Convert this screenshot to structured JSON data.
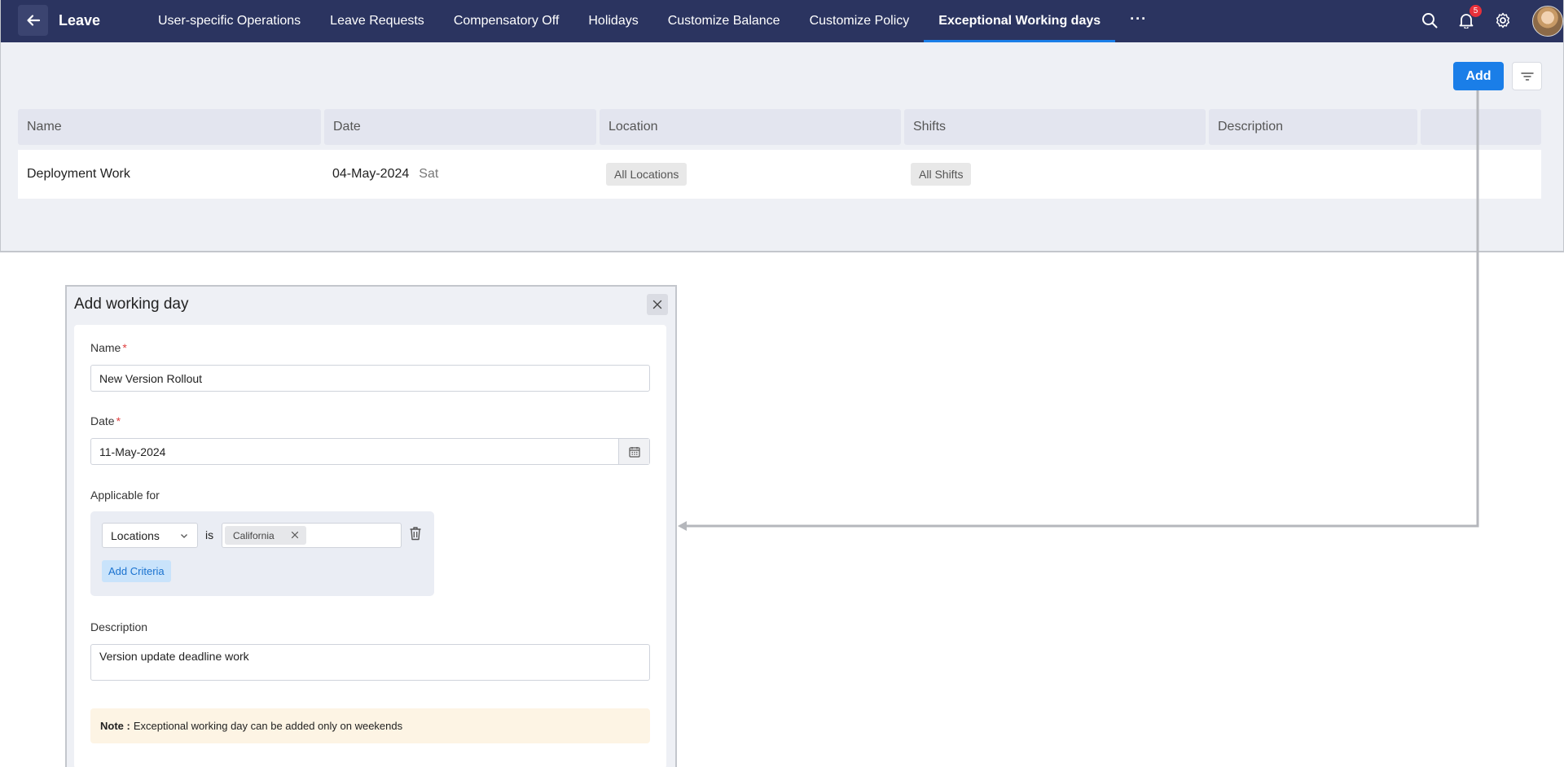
{
  "topnav": {
    "app_title": "Leave",
    "tabs": [
      {
        "label": "User-specific Operations"
      },
      {
        "label": "Leave Requests"
      },
      {
        "label": "Compensatory Off"
      },
      {
        "label": "Holidays"
      },
      {
        "label": "Customize Balance"
      },
      {
        "label": "Customize Policy"
      },
      {
        "label": "Exceptional Working days"
      },
      {
        "label": "···"
      }
    ],
    "notification_count": "5",
    "icons": [
      "back-arrow-icon",
      "search-icon",
      "bell-icon",
      "gear-icon"
    ]
  },
  "toolbar": {
    "add_label": "Add",
    "filter_icon": "filter-icon"
  },
  "table": {
    "columns": [
      "Name",
      "Date",
      "Location",
      "Shifts",
      "Description",
      ""
    ],
    "rows": [
      {
        "name": "Deployment Work",
        "date": "04-May-2024",
        "day": "Sat",
        "location": "All Locations",
        "shifts": "All Shifts",
        "description": ""
      }
    ]
  },
  "dialog": {
    "title": "Add working day",
    "name_label": "Name",
    "name_value": "New Version Rollout",
    "date_label": "Date",
    "date_value": "11-May-2024",
    "required_mark": "*",
    "applicable_label": "Applicable for",
    "criteria": {
      "field": "Locations",
      "operator": "is",
      "values": [
        "California"
      ]
    },
    "add_criteria_label": "Add Criteria",
    "description_label": "Description",
    "description_value": "Version update deadline work",
    "note_prefix": "Note :",
    "note_text": "Exceptional working day can be added only on weekends"
  },
  "colors": {
    "nav_bg": "#2b3460",
    "accent": "#1a7ee8",
    "page_bg": "#eef0f5",
    "required": "#e04040",
    "note_bg": "#fdf4e4"
  }
}
